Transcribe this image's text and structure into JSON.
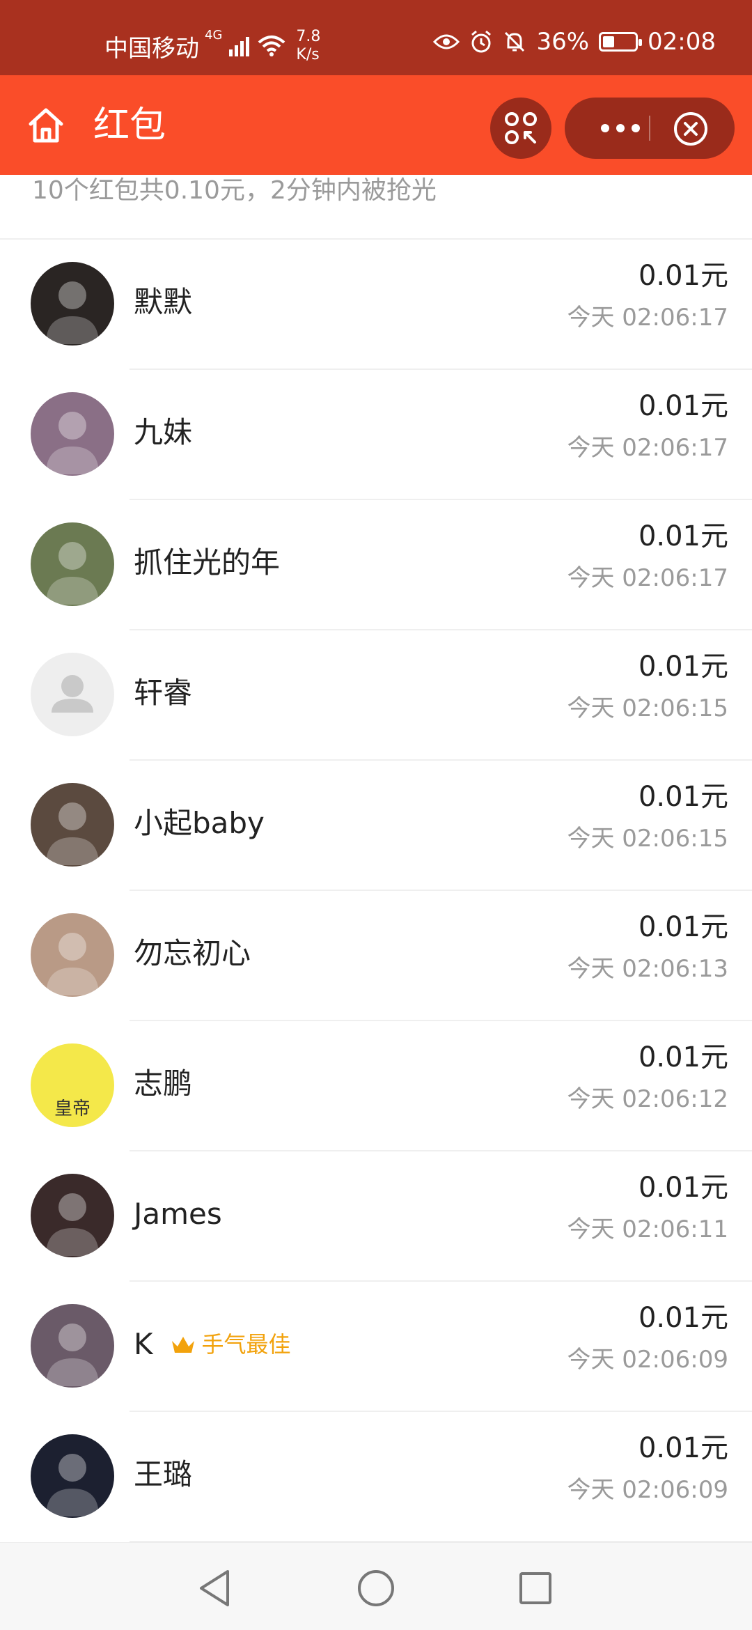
{
  "status_bar": {
    "carrier": "中国移动",
    "network_type": "4G",
    "speed_value": "7.8",
    "speed_unit": "K/s",
    "battery": "36%",
    "battery_level": 0.36,
    "time": "02:08"
  },
  "header": {
    "title": "红包",
    "icons": [
      "home-icon",
      "scan-icon",
      "more-icon",
      "close-icon"
    ]
  },
  "summary": "10个红包共0.10元，2分钟内被抢光",
  "records": [
    {
      "name": "默默",
      "amount": "0.01元",
      "time": "今天 02:06:17",
      "avatar_bg": "#2a2523"
    },
    {
      "name": "九妹",
      "amount": "0.01元",
      "time": "今天 02:06:17",
      "avatar_bg": "#8a6f86"
    },
    {
      "name": "抓住光的年",
      "amount": "0.01元",
      "time": "今天 02:06:17",
      "avatar_bg": "#6b7a52"
    },
    {
      "name": "轩睿",
      "amount": "0.01元",
      "time": "今天 02:06:15",
      "avatar_bg": "#eeeeee"
    },
    {
      "name": "小起baby",
      "amount": "0.01元",
      "time": "今天 02:06:15",
      "avatar_bg": "#5b4a3f"
    },
    {
      "name": "勿忘初心",
      "amount": "0.01元",
      "time": "今天 02:06:13",
      "avatar_bg": "#b99a86"
    },
    {
      "name": "志鹏",
      "amount": "0.01元",
      "time": "今天 02:06:12",
      "avatar_bg": "#f4e84a",
      "avatar_text": "皇帝"
    },
    {
      "name": "James",
      "amount": "0.01元",
      "time": "今天 02:06:11",
      "avatar_bg": "#3a2a2a"
    },
    {
      "name": "K",
      "amount": "0.01元",
      "time": "今天 02:06:09",
      "avatar_bg": "#6a5a68",
      "badge": "手气最佳"
    },
    {
      "name": "王璐",
      "amount": "0.01元",
      "time": "今天 02:06:09",
      "avatar_bg": "#1c2030"
    }
  ],
  "nav": [
    "back-icon",
    "home-circle-icon",
    "recents-icon"
  ],
  "colors": {
    "status_bar": "#a9311f",
    "header": "#fa4d29",
    "header_button": "#9a2b1b",
    "badge": "#f2a20c"
  }
}
